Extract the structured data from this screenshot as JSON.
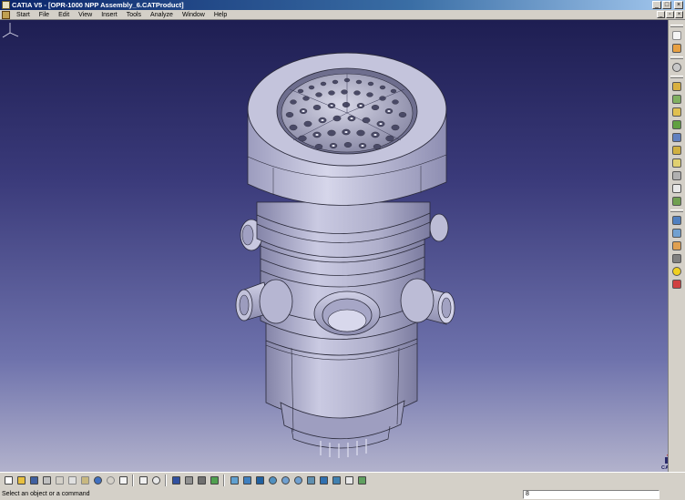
{
  "window": {
    "title": "CATIA V5 - [OPR-1000 NPP Assembly_6.CATProduct]"
  },
  "menubar": {
    "items": [
      "Start",
      "File",
      "Edit",
      "View",
      "Insert",
      "Tools",
      "Analyze",
      "Window",
      "Help"
    ]
  },
  "viewport": {
    "model": "reactor-vessel-assembly",
    "logo_text": "CATIA"
  },
  "status": {
    "message": "Select an object or a command",
    "command_value": "8"
  },
  "colors": {
    "background_top": "#1e1e52",
    "background_bottom": "#b2b2cc",
    "model_fill": "#b4b4d2",
    "model_edge": "#2a2a3a",
    "ui_face": "#d4d0c8"
  },
  "right_toolbar_icons": [
    "cursor-icon",
    "fly-mode-icon",
    "new-component-icon",
    "new-product-icon",
    "new-part-icon",
    "existing-component-icon",
    "replace-component-icon",
    "graph-tree-reorder-icon",
    "generate-numbering-icon",
    "selective-load-icon",
    "manage-representations-icon",
    "multi-instantiation-icon",
    "fast-multi-instantiation-icon",
    "reuse-pattern-icon",
    "manipulation-icon",
    "snap-icon",
    "explode-icon",
    "stop-on-clash-icon",
    "coincidence-constraint-icon",
    "contact-constraint-icon",
    "fix-component-icon",
    "update-all-icon"
  ],
  "bottom_toolbar_icons": [
    "new-icon",
    "open-icon",
    "save-icon",
    "print-icon",
    "cut-icon",
    "copy-icon",
    "paste-icon",
    "undo-icon",
    "redo-icon",
    "whats-this-icon",
    "formula-icon",
    "knowledge-icon",
    "catalog-icon",
    "measure-icon",
    "analysis-icon",
    "fly-icon",
    "fit-all-icon",
    "pan-icon",
    "rotate-icon",
    "zoom-in-icon",
    "zoom-out-icon",
    "normal-view-icon",
    "iso-view-icon",
    "shading-icon",
    "hide-show-icon",
    "swap-space-icon"
  ]
}
